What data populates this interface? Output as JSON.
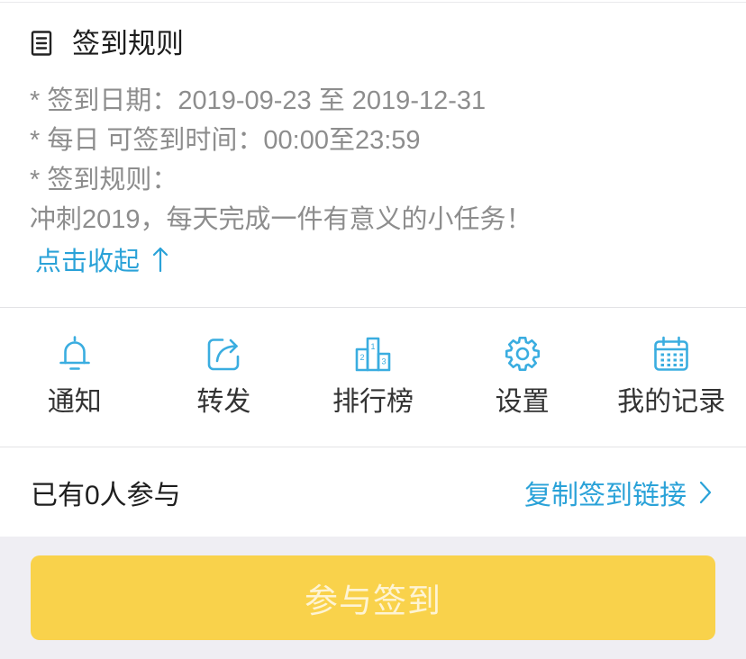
{
  "theme": {
    "accent": "#2aa2d8",
    "icon": "#3aade0",
    "button": "#f9d24b",
    "button_text": "#fef4d4",
    "muted_text": "#8d8d8d",
    "page_bg": "#efeef3"
  },
  "rules": {
    "icon": "document-list-icon",
    "title": "签到规则",
    "lines": [
      "* 签到日期：2019-09-23 至 2019-12-31",
      "* 每日 可签到时间：00:00至23:59",
      "* 签到规则：",
      "冲刺2019，每天完成一件有意义的小任务！"
    ],
    "collapse": {
      "label": "点击收起",
      "icon": "arrow-up-icon"
    }
  },
  "actions": [
    {
      "label": "通知",
      "icon": "bell-icon"
    },
    {
      "label": "转发",
      "icon": "share-icon"
    },
    {
      "label": "排行榜",
      "icon": "leaderboard-podium-icon",
      "ranks": [
        "2",
        "1",
        "3"
      ]
    },
    {
      "label": "设置",
      "icon": "gear-icon"
    },
    {
      "label": "我的记录",
      "icon": "calendar-icon"
    }
  ],
  "participants": {
    "count_text": "已有0人参与",
    "copy_link": {
      "label": "复制签到链接",
      "icon": "chevron-right-icon"
    }
  },
  "join_button": {
    "label": "参与签到"
  }
}
